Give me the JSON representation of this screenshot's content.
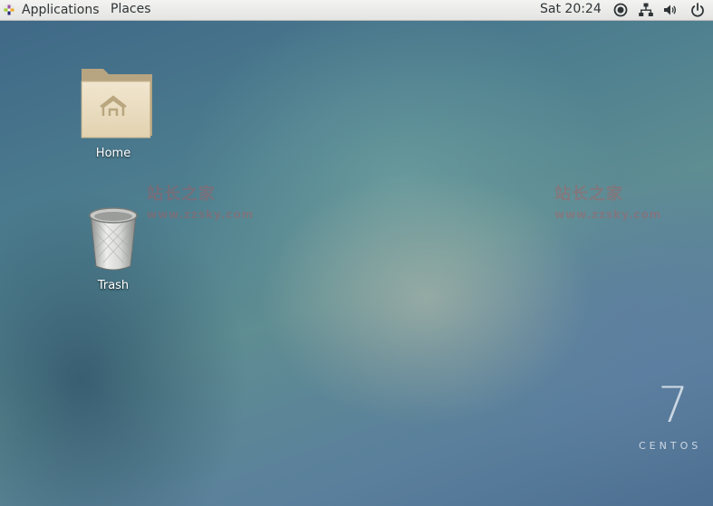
{
  "topbar": {
    "applications_label": "Applications",
    "places_label": "Places",
    "clock": "Sat 20:24",
    "tray_icons": [
      "accessibility-icon",
      "network-icon",
      "volume-icon",
      "power-icon"
    ]
  },
  "desktop": {
    "icons": [
      {
        "label": "Home",
        "icon": "home-folder-icon"
      },
      {
        "label": "Trash",
        "icon": "trash-icon"
      }
    ]
  },
  "watermark": {
    "logo_text": "站长之家",
    "url_text": "www.zzsky.com"
  },
  "branding": {
    "version": "7",
    "name": "CENTOS"
  }
}
